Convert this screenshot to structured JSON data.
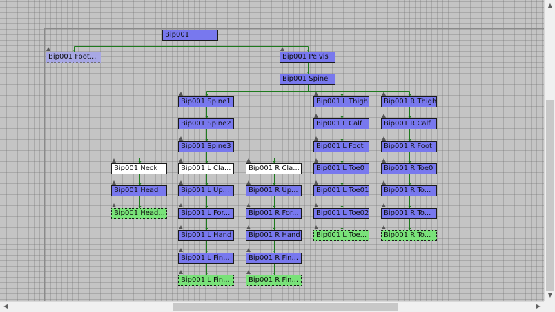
{
  "nodes": [
    {
      "id": "bip001",
      "label": "Bip001",
      "state": "normal",
      "marker": false
    },
    {
      "id": "footsteps",
      "label": "Bip001 Foot...",
      "state": "dummy",
      "marker": true
    },
    {
      "id": "pelvis",
      "label": "Bip001 Pelvis",
      "state": "normal",
      "marker": true
    },
    {
      "id": "spine",
      "label": "Bip001 Spine",
      "state": "normal",
      "marker": false
    },
    {
      "id": "spine1",
      "label": "Bip001 Spine1",
      "state": "normal",
      "marker": true
    },
    {
      "id": "spine2",
      "label": "Bip001 Spine2",
      "state": "normal",
      "marker": false
    },
    {
      "id": "spine3",
      "label": "Bip001 Spine3",
      "state": "normal",
      "marker": true
    },
    {
      "id": "neck",
      "label": "Bip001 Neck",
      "state": "selected",
      "marker": true
    },
    {
      "id": "head",
      "label": "Bip001 Head",
      "state": "normal",
      "marker": true
    },
    {
      "id": "headnub",
      "label": "Bip001 Head...",
      "state": "leaf",
      "marker": true
    },
    {
      "id": "lclav",
      "label": "Bip001 L Cla...",
      "state": "selected",
      "marker": true
    },
    {
      "id": "luparm",
      "label": "Bip001 L Up...",
      "state": "normal",
      "marker": true
    },
    {
      "id": "lforearm",
      "label": "Bip001 L For...",
      "state": "normal",
      "marker": true
    },
    {
      "id": "lhand",
      "label": "Bip001 L Hand",
      "state": "normal",
      "marker": true
    },
    {
      "id": "lfinger",
      "label": "Bip001 L Fin...",
      "state": "normal",
      "marker": true
    },
    {
      "id": "lfingernub",
      "label": "Bip001 L Fin...",
      "state": "leaf",
      "marker": true
    },
    {
      "id": "rclav",
      "label": "Bip001 R Cla...",
      "state": "selected",
      "marker": true
    },
    {
      "id": "ruparm",
      "label": "Bip001 R Up...",
      "state": "normal",
      "marker": true
    },
    {
      "id": "rforearm",
      "label": "Bip001 R For...",
      "state": "normal",
      "marker": true
    },
    {
      "id": "rhand",
      "label": "Bip001 R Hand",
      "state": "normal",
      "marker": true
    },
    {
      "id": "rfinger",
      "label": "Bip001 R Fin...",
      "state": "normal",
      "marker": true
    },
    {
      "id": "rfingernub",
      "label": "Bip001 R Fin...",
      "state": "leaf",
      "marker": true
    },
    {
      "id": "lthigh",
      "label": "Bip001 L Thigh",
      "state": "normal",
      "marker": true
    },
    {
      "id": "lcalf",
      "label": "Bip001 L Calf",
      "state": "normal",
      "marker": true
    },
    {
      "id": "lfoot",
      "label": "Bip001 L Foot",
      "state": "normal",
      "marker": true
    },
    {
      "id": "ltoe0",
      "label": "Bip001 L Toe0",
      "state": "normal",
      "marker": true
    },
    {
      "id": "ltoe01",
      "label": "Bip001 L Toe01",
      "state": "normal",
      "marker": true
    },
    {
      "id": "ltoe02",
      "label": "Bip001 L Toe02",
      "state": "normal",
      "marker": true
    },
    {
      "id": "ltoenub",
      "label": "Bip001 L Toe...",
      "state": "leaf",
      "marker": true
    },
    {
      "id": "rthigh",
      "label": "Bip001 R Thigh",
      "state": "normal",
      "marker": true
    },
    {
      "id": "rcalf",
      "label": "Bip001 R Calf",
      "state": "normal",
      "marker": true
    },
    {
      "id": "rfoot",
      "label": "Bip001 R Foot",
      "state": "normal",
      "marker": true
    },
    {
      "id": "rtoe0",
      "label": "Bip001 R Toe0",
      "state": "normal",
      "marker": true
    },
    {
      "id": "rtoe01",
      "label": "Bip001 R To...",
      "state": "normal",
      "marker": true
    },
    {
      "id": "rtoe02",
      "label": "Bip001 R To...",
      "state": "normal",
      "marker": true
    },
    {
      "id": "rtoenub",
      "label": "Bip001 R To...",
      "state": "leaf",
      "marker": true
    }
  ],
  "links": [
    [
      "bip001",
      "footsteps"
    ],
    [
      "bip001",
      "pelvis"
    ],
    [
      "pelvis",
      "spine"
    ],
    [
      "spine",
      "spine1"
    ],
    [
      "spine",
      "lthigh"
    ],
    [
      "spine",
      "rthigh"
    ],
    [
      "spine1",
      "spine2"
    ],
    [
      "spine2",
      "spine3"
    ],
    [
      "spine3",
      "neck"
    ],
    [
      "spine3",
      "lclav"
    ],
    [
      "spine3",
      "rclav"
    ],
    [
      "neck",
      "head"
    ],
    [
      "head",
      "headnub"
    ],
    [
      "lclav",
      "luparm"
    ],
    [
      "luparm",
      "lforearm"
    ],
    [
      "lforearm",
      "lhand"
    ],
    [
      "lhand",
      "lfinger"
    ],
    [
      "lfinger",
      "lfingernub"
    ],
    [
      "rclav",
      "ruparm"
    ],
    [
      "ruparm",
      "rforearm"
    ],
    [
      "rforearm",
      "rhand"
    ],
    [
      "rhand",
      "rfinger"
    ],
    [
      "rfinger",
      "rfingernub"
    ],
    [
      "lthigh",
      "lcalf"
    ],
    [
      "lcalf",
      "lfoot"
    ],
    [
      "lfoot",
      "ltoe0"
    ],
    [
      "ltoe0",
      "ltoe01"
    ],
    [
      "ltoe01",
      "ltoe02"
    ],
    [
      "ltoe02",
      "ltoenub"
    ],
    [
      "rthigh",
      "rcalf"
    ],
    [
      "rcalf",
      "rfoot"
    ],
    [
      "rfoot",
      "rtoe0"
    ],
    [
      "rtoe0",
      "rtoe01"
    ],
    [
      "rtoe01",
      "rtoe02"
    ],
    [
      "rtoe02",
      "rtoenub"
    ]
  ],
  "colors": {
    "link": "#1e7a1e",
    "node_normal": "#7878ee",
    "node_selected": "#ffffff",
    "node_leaf": "#79e279",
    "node_dummy": "#a8a8e4"
  },
  "scrollbars": {
    "horizontal": {
      "position_fraction": 0.31,
      "visible_fraction": 0.43
    },
    "vertical": {
      "position_fraction": 0.32,
      "visible_fraction": 0.68
    }
  }
}
